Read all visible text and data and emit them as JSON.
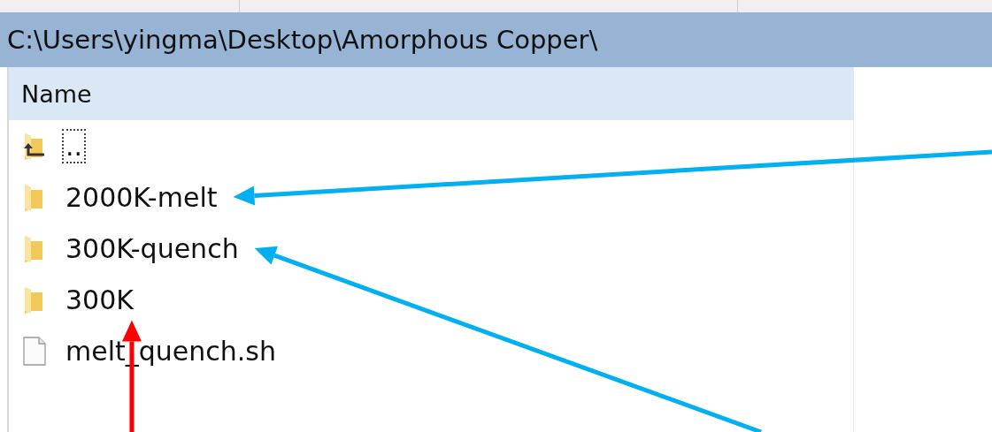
{
  "path_bar": {
    "text": "C:\\Users\\yingma\\Desktop\\Amorphous Copper\\"
  },
  "file_list": {
    "columns": [
      "Name"
    ],
    "rows": [
      {
        "name": "..",
        "kind": "parent",
        "focused": true
      },
      {
        "name": "2000K-melt",
        "kind": "folder",
        "focused": false,
        "arrow": {
          "kind": "right",
          "color": "#00b0f0"
        }
      },
      {
        "name": "300K-quench",
        "kind": "folder",
        "focused": false,
        "arrow": {
          "kind": "lowerright",
          "color": "#00b0f0"
        }
      },
      {
        "name": "300K",
        "kind": "folder",
        "focused": false,
        "arrow": {
          "kind": "below",
          "color": "#ff0000"
        }
      },
      {
        "name": "melt_quench.sh",
        "kind": "file",
        "focused": false
      }
    ]
  }
}
